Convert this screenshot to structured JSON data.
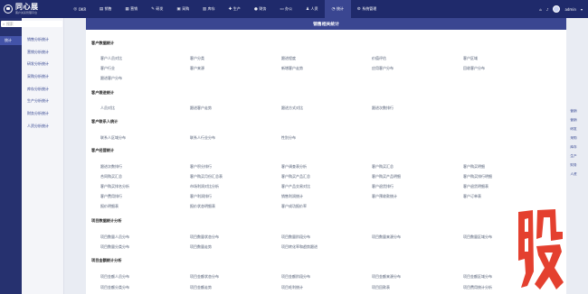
{
  "header": {
    "logo_title": "同心展",
    "logo_subtitle": "客户关系管理平台",
    "nav": [
      {
        "label": "OKR",
        "icon": "◎"
      },
      {
        "label": "销售",
        "icon": "▤"
      },
      {
        "label": "营销",
        "icon": "▦"
      },
      {
        "label": "研发",
        "icon": "✎"
      },
      {
        "label": "采购",
        "icon": "▣"
      },
      {
        "label": "库存",
        "icon": "▥"
      },
      {
        "label": "生产",
        "icon": "✚"
      },
      {
        "label": "财务",
        "icon": "●"
      },
      {
        "label": "办公",
        "icon": "▭"
      },
      {
        "label": "人资",
        "icon": "♟"
      },
      {
        "label": "统计",
        "icon": "◔"
      },
      {
        "label": "系统管理",
        "icon": "⚙"
      }
    ],
    "user": "admin"
  },
  "sidebar": {
    "search_placeholder": "搜索",
    "items": [
      {
        "label": "统计"
      }
    ]
  },
  "submenu": {
    "items": [
      {
        "label": "销售分析统计"
      },
      {
        "label": "营销分析统计"
      },
      {
        "label": "研发分析统计"
      },
      {
        "label": "采购分析统计"
      },
      {
        "label": "库存分析统计"
      },
      {
        "label": "生产分析统计"
      },
      {
        "label": "财务分析统计"
      },
      {
        "label": "人资分析统计"
      }
    ]
  },
  "content": {
    "title": "销售相关统计",
    "sections": [
      {
        "title": "客户数据统计",
        "rows": [
          [
            "客户人员对比",
            "客户分类",
            "跟进程度",
            "价值评估",
            "客户区域"
          ],
          [
            "客户行业",
            "客户来源",
            "新增客户走势",
            "应用客户分布",
            "回收客户分布"
          ],
          [
            "跟进客户分布"
          ]
        ]
      },
      {
        "title": "客户跟进统计",
        "rows": [
          [
            "人员对比",
            "跟进客户走势",
            "跟进方式对比",
            "跟进次数排行"
          ]
        ]
      },
      {
        "title": "客户联系人统计",
        "rows": [
          [
            "联系人区域分布",
            "联系人行业分布",
            "性别分布"
          ]
        ]
      },
      {
        "title": "客户经营统计",
        "rows": [
          [
            "跟进次数排行",
            "客户积分排行",
            "客户调查表分析",
            "客户购买汇总",
            "客户购买明细"
          ],
          [
            "合同购买汇总",
            "客户购买月份汇总表",
            "客户购买产品汇总",
            "客户购买产品明细",
            "客户购买排行明细"
          ],
          [
            "客户购买排名分析",
            "市场利润对比分析",
            "客户产品交易对比",
            "客户退货排行",
            "客户退货明细表"
          ],
          [
            "客户费用排行",
            "客户利润排行",
            "销售利润统计",
            "客户预收款统计",
            "客户订单表"
          ],
          [
            "报价明细表",
            "报价状态明细表",
            "客户成功报价率"
          ]
        ]
      },
      {
        "title": "项目数据统计分析",
        "rows": [
          [
            "项目数量人员分布",
            "项目数量状态分布",
            "项目数量阶段分布",
            "项目数量来源分布",
            "项目数量区域分布"
          ],
          [
            "项目数量分类分布",
            "项目数量走势",
            "项目转化率和趋势跟进"
          ]
        ]
      },
      {
        "title": "项目金额统计分析",
        "rows": [
          [
            "项目金额人员分布",
            "项目金额状态分布",
            "项目金额阶段分布",
            "项目金额来源分布",
            "项目金额区域分布"
          ],
          [
            "项目金额分类分布",
            "项目金额走势",
            "项目毛利统计",
            "项目回款表",
            "项目费用统计分析"
          ]
        ]
      }
    ]
  },
  "right_rail": {
    "items": [
      {
        "label": "营销"
      },
      {
        "label": "营销"
      },
      {
        "label": "研发"
      },
      {
        "label": "采购"
      },
      {
        "label": "库存"
      },
      {
        "label": "生产"
      },
      {
        "label": "财务"
      },
      {
        "label": "人资"
      }
    ]
  },
  "watermark": {
    "text": "股",
    "color": "#e4402f"
  }
}
